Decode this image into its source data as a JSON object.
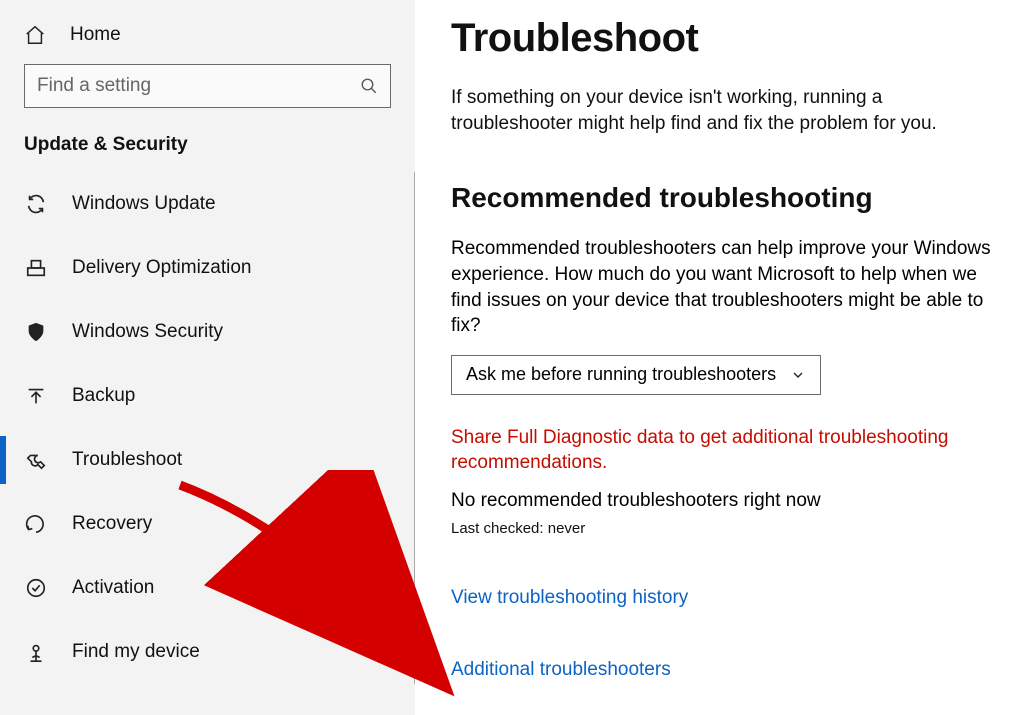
{
  "sidebar": {
    "home_label": "Home",
    "search_placeholder": "Find a setting",
    "section_title": "Update & Security",
    "items": [
      {
        "label": "Windows Update",
        "icon": "sync-icon"
      },
      {
        "label": "Delivery Optimization",
        "icon": "delivery-icon"
      },
      {
        "label": "Windows Security",
        "icon": "shield-icon"
      },
      {
        "label": "Backup",
        "icon": "backup-icon"
      },
      {
        "label": "Troubleshoot",
        "icon": "wrench-icon",
        "selected": true
      },
      {
        "label": "Recovery",
        "icon": "recovery-icon"
      },
      {
        "label": "Activation",
        "icon": "activation-icon"
      },
      {
        "label": "Find my device",
        "icon": "find-device-icon"
      }
    ]
  },
  "main": {
    "title": "Troubleshoot",
    "intro": "If something on your device isn't working, running a troubleshooter might help find and fix the problem for you.",
    "section_heading": "Recommended troubleshooting",
    "section_desc": "Recommended troubleshooters can help improve your Windows experience. How much do you want Microsoft to help when we find issues on your device that troubleshooters might be able to fix?",
    "dropdown_value": "Ask me before running troubleshooters",
    "warning": "Share Full Diagnostic data to get additional troubleshooting recommendations.",
    "no_rec": "No recommended troubleshooters right now",
    "last_checked": "Last checked: never",
    "link_history": "View troubleshooting history",
    "link_additional": "Additional troubleshooters"
  }
}
